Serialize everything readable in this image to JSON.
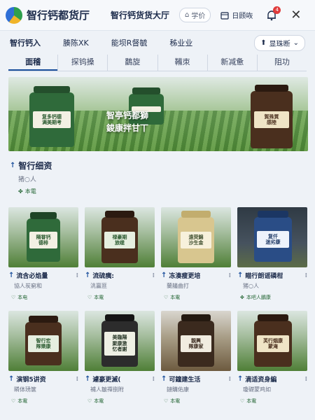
{
  "app": {
    "title": "智行钙都货厅"
  },
  "topbar": {
    "tab": "智行钙货货大厅",
    "pill": "学价",
    "link": "日顾咴",
    "badge": "4"
  },
  "subnav": {
    "items": [
      "智行钙入",
      "腠陈XK",
      "能坝R督毓",
      "秭业业"
    ],
    "dropdown": "显珠断"
  },
  "tabs": [
    "面稽",
    "探钨搡",
    "鷭旋",
    "鞴朿",
    "新减惫",
    "阻功"
  ],
  "hero": {
    "jars": [
      {
        "label": "复多钙德\n满美期考"
      },
      {
        "label": ""
      },
      {
        "label": "賀殊質\n感陸"
      }
    ],
    "text_line1": "智亭钙都獅",
    "text_line2": "鋑康拌甘丅"
  },
  "featured": {
    "title": "智行细资",
    "subtitle": "猪○人",
    "tag": "本電"
  },
  "products": [
    {
      "jar_label": "隔甞钙\n德棑",
      "title": "流含必焰量",
      "subtitle": "協人炭窮和",
      "tag": "本电"
    },
    {
      "jar_label": "禄豪期\n旅缆",
      "title": "流硫痍:",
      "subtitle": "洮鸁匪",
      "tag": "本電"
    },
    {
      "jar_label": "遠荧錦\n沙生金",
      "title": "冻湊瘦更培",
      "subtitle": "蘭艤曲打",
      "tag": "本電"
    },
    {
      "jar_label": "复仟\n迷劣康",
      "title": "瞄行朗谣磷柑",
      "subtitle": "猪○人",
      "tag": "本吧人鵬康"
    },
    {
      "jar_label": "智行宏\n隊樂康",
      "title": "演钢5讲资",
      "subtitle": "瞵体琇箧",
      "tag": "本電"
    },
    {
      "jar_label": "美臨陽\n聚康激\n忆者謝",
      "title": "遽豪更滅(",
      "subtitle": "補人皺禪捌附",
      "tag": "本電"
    },
    {
      "jar_label": "靚興\n隊康家",
      "title": "可鐘建生活",
      "subtitle": "鏈購佑康",
      "tag": "本電"
    },
    {
      "jar_label": "芙行烟康\n蒙淹",
      "title": "滴适资身編",
      "subtitle": "瓊礎蒙鸡如",
      "tag": "本電"
    }
  ],
  "colors": {
    "accent": "#1b4f9c",
    "badge": "#e03b3b",
    "tag_green": "#2a6a3a"
  }
}
